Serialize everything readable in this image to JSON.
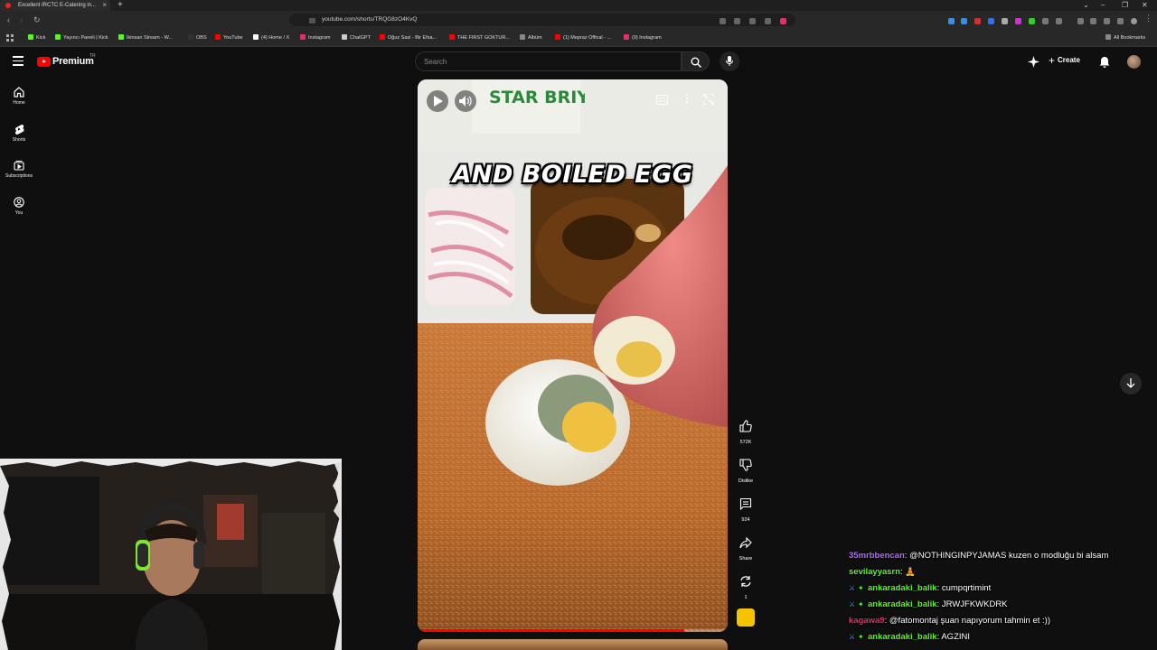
{
  "browser": {
    "tab_title": "Excellent IRCTC E-Catering in...",
    "url": "youtube.com/shorts/TRQG8zO4KvQ",
    "bookmarks": [
      {
        "label": "Kick",
        "color": "#53fc18"
      },
      {
        "label": "Yayıncı Paneli | Kick",
        "color": "#53fc18"
      },
      {
        "label": "İkinsan Stream - W...",
        "color": "#53fc18"
      },
      {
        "label": "OBS",
        "color": "#333333"
      },
      {
        "label": "YouTube",
        "color": "#ff0000"
      },
      {
        "label": "(4) Home / X",
        "color": "#ffffff"
      },
      {
        "label": "Instagram",
        "color": "#e1306c"
      },
      {
        "label": "ChatGPT",
        "color": "#cccccc"
      },
      {
        "label": "Oğuz Sasi - Bir Efsa...",
        "color": "#ff0000"
      },
      {
        "label": "THE FIRST GOKTUR...",
        "color": "#ff0000"
      },
      {
        "label": "Albüm",
        "color": "#888888"
      },
      {
        "label": "(1) Mepraz Offical - ...",
        "color": "#ff0000"
      },
      {
        "label": "(9) Instagram",
        "color": "#e1306c"
      }
    ],
    "all_bookmarks": "All Bookmarks"
  },
  "header": {
    "brand": "Premium",
    "brand_sup": "TR",
    "search_placeholder": "Search",
    "create_label": "Create"
  },
  "sidebar": {
    "items": [
      {
        "label": "Home",
        "icon": "home-icon"
      },
      {
        "label": "Shorts",
        "icon": "shorts-icon"
      },
      {
        "label": "Subscriptions",
        "icon": "subscriptions-icon"
      },
      {
        "label": "You",
        "icon": "you-icon"
      }
    ]
  },
  "short": {
    "caption": "AND BOILED EGG",
    "sign_text": "STAR BRIYANI",
    "progress": 0.86
  },
  "actions": {
    "likes": "572K",
    "dislike": "Dislike",
    "comments": "924",
    "share": "Share",
    "remix": "1"
  },
  "chat": [
    {
      "user": "35mrbbencan",
      "color": "#b46ef5",
      "text": "@NOTHINGINPYJAMAS kuzen o modluğu bi alsam",
      "badges": false
    },
    {
      "user": "sevilayyasrn",
      "color": "#53fc18",
      "text": "🧘",
      "badges": false
    },
    {
      "user": "ankaradaki_balik",
      "color": "#53fc18",
      "text": "cumpqrtimint",
      "badges": true
    },
    {
      "user": "ankaradaki_balik",
      "color": "#53fc18",
      "text": "JRWJFKWKDRK",
      "badges": true
    },
    {
      "user": "kagawa9",
      "color": "#e0316c",
      "text": "@fatomontaj şuan napıyorum tahmin et :))",
      "badges": false
    },
    {
      "user": "ankaradaki_balik",
      "color": "#53fc18",
      "text": "AGZINI",
      "badges": true
    }
  ]
}
